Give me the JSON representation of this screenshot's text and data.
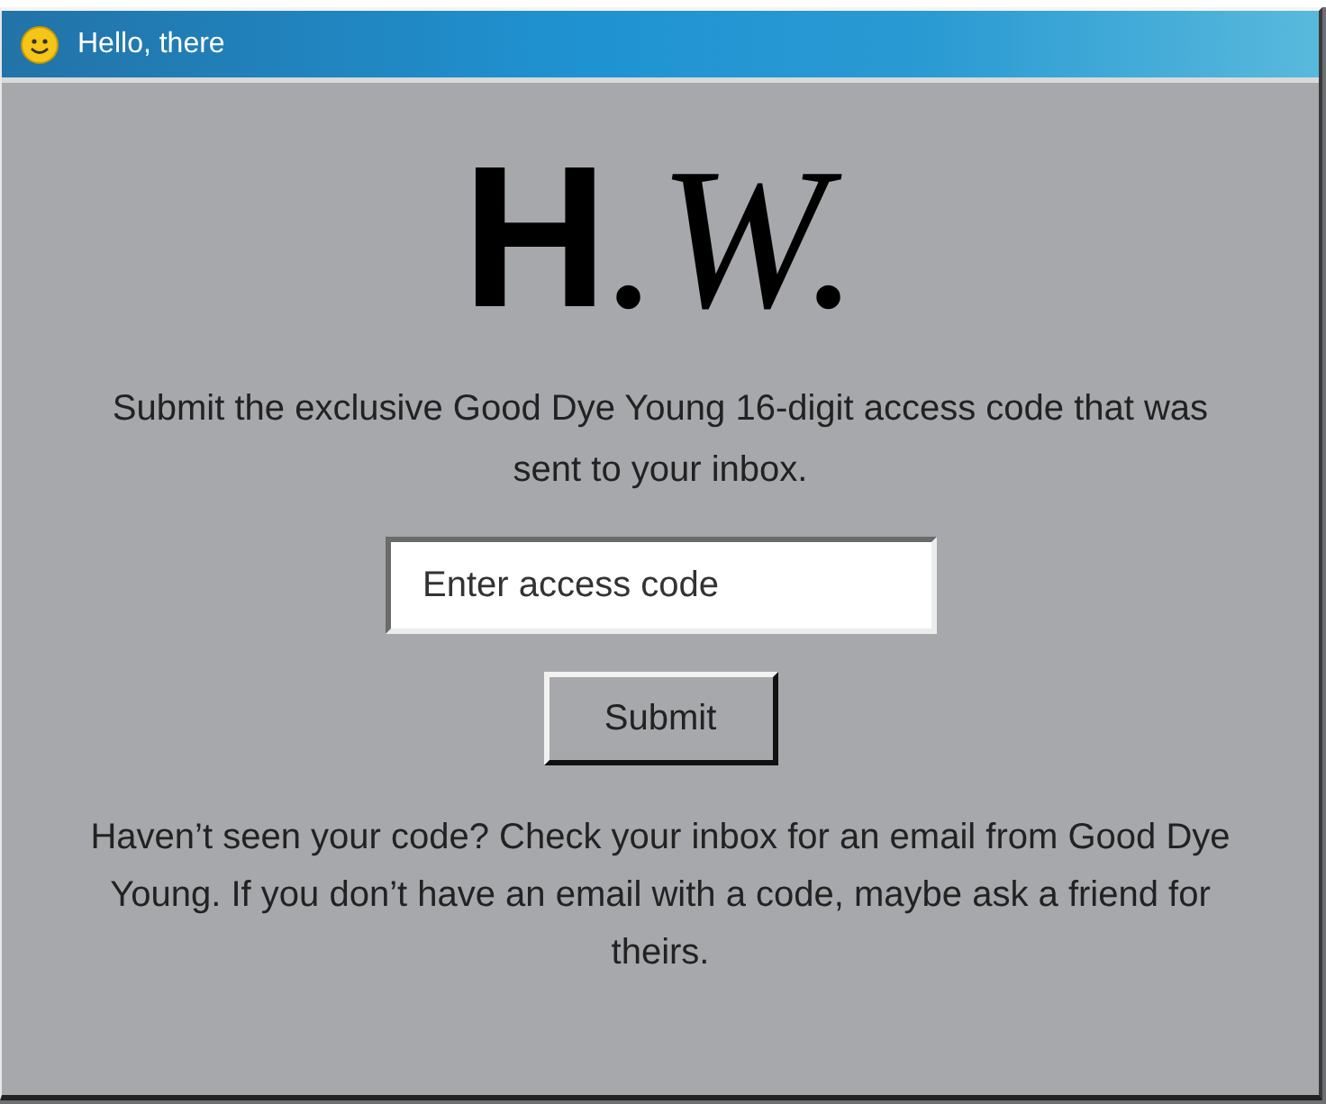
{
  "window": {
    "title": "Hello, there"
  },
  "logo": {
    "initial": "H",
    "script": ".W."
  },
  "intro": "Submit the exclusive Good Dye Young 16-digit access code that was sent to your inbox.",
  "code_field": {
    "placeholder": "Enter access code"
  },
  "submit_button": "Submit",
  "help_text": "Haven’t seen your code? Check your inbox for an email from Good Dye Young. If you don’t have an email with a code, maybe ask a friend for theirs."
}
